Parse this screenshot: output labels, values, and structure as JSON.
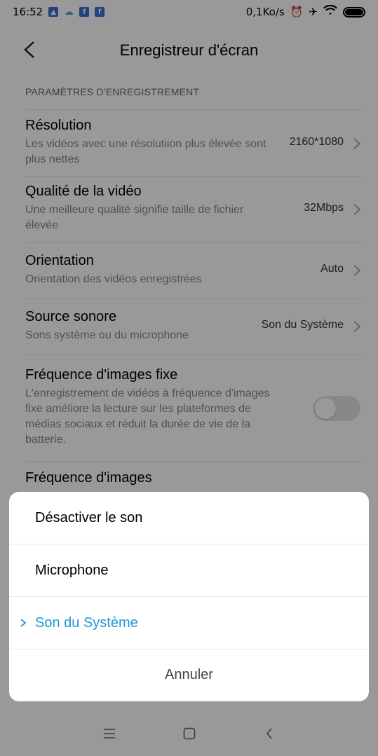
{
  "status_bar": {
    "time": "16:52",
    "network_speed": "0,1Ko/s",
    "icons": [
      "gallery-icon",
      "cloud-icon",
      "facebook-icon",
      "facebook-icon",
      "alarm-icon",
      "airplane-mode-icon",
      "wifi-icon",
      "battery-icon"
    ]
  },
  "app_bar": {
    "title": "Enregistreur d'écran"
  },
  "settings": {
    "section_header": "PARAMÈTRES D'ENREGISTREMENT",
    "items": [
      {
        "title": "Résolution",
        "description": "Les vidéos avec une résolutiion plus élevée sont plus nettes",
        "value": "2160*1080"
      },
      {
        "title": "Qualité de la vidéo",
        "description": "Une meilleure qualité signifie taille de fichier élevée",
        "value": "32Mbps"
      },
      {
        "title": "Orientation",
        "description": "Orientation des vidéos enregistrées",
        "value": "Auto"
      },
      {
        "title": "Source sonore",
        "description": "Sons système ou du microphone",
        "value": "Son du Système"
      },
      {
        "title": "Fréquence d'images fixe",
        "description": "L'enregistrement de vidéos à fréquence d'images fixe améliore la lecture sur les plateformes de médias sociaux et réduit la durée de vie de la batterie.",
        "toggle_on": false
      },
      {
        "title": "Fréquence d'images"
      }
    ]
  },
  "dialog": {
    "options": [
      {
        "label": "Désactiver le son",
        "selected": false
      },
      {
        "label": "Microphone",
        "selected": false
      },
      {
        "label": "Son du Système",
        "selected": true
      }
    ],
    "cancel_label": "Annuler"
  },
  "colors": {
    "accent": "#2196d3",
    "scrim": "rgba(0,0,0,0.4)"
  }
}
